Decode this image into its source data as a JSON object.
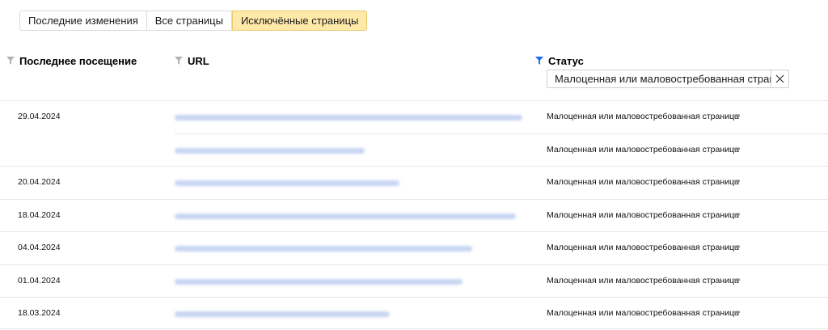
{
  "tabs": [
    {
      "label": "Последние изменения",
      "active": false
    },
    {
      "label": "Все страницы",
      "active": false
    },
    {
      "label": "Исключённые страницы",
      "active": true
    }
  ],
  "columns": {
    "last_visit": "Последнее посещение",
    "url": "URL",
    "status": "Статус"
  },
  "status_filter": {
    "value": "Малоценная или маловостребованная страница"
  },
  "rows": [
    {
      "date": "29.04.2024",
      "status": "Малоценная или маловостребованная страница"
    },
    {
      "date": "",
      "status": "Малоценная или маловостребованная страница"
    },
    {
      "date": "20.04.2024",
      "status": "Малоценная или маловостребованная страница"
    },
    {
      "date": "18.04.2024",
      "status": "Малоценная или маловостребованная страница"
    },
    {
      "date": "04.04.2024",
      "status": "Малоценная или маловостребованная страница"
    },
    {
      "date": "01.04.2024",
      "status": "Малоценная или маловостребованная страница"
    },
    {
      "date": "18.03.2024",
      "status": "Малоценная или маловостребованная страница"
    }
  ],
  "more_label": "•••",
  "icons": {
    "filter": "filter-icon",
    "clear": "close-icon",
    "more": "more-icon"
  },
  "colors": {
    "active_tab": "#ffe9a8",
    "filter_active": "#1a6ef5",
    "filter_inactive": "#b3b3b3"
  }
}
